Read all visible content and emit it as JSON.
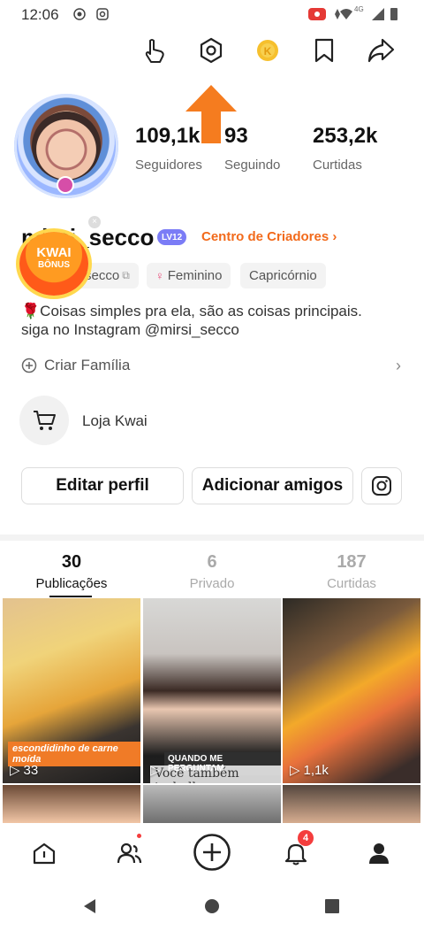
{
  "status_bar": {
    "time": "12:06",
    "network": "4G"
  },
  "profile": {
    "followers_count": "109,1k",
    "followers_label": "Seguidores",
    "following_count": "93",
    "following_label": "Seguindo",
    "likes_count": "253,2k",
    "likes_label": "Curtidas",
    "username": "mirsi_secco",
    "level": "LV12",
    "creator_center": "Centro de Criadores",
    "chips": [
      "secco",
      "Feminino",
      "Capricórnio"
    ],
    "bio": "🌹Coisas simples pra ela, são as coisas principais. siga no Instagram @mirsi_secco",
    "family_label": "Criar Família",
    "store_label": "Loja Kwai",
    "bonus_title": "KWAI",
    "bonus_sub": "BÔNUS"
  },
  "buttons": {
    "edit_profile": "Editar perfil",
    "add_friends": "Adicionar amigos"
  },
  "tabs": [
    {
      "count": "30",
      "label": "Publicações"
    },
    {
      "count": "6",
      "label": "Privado"
    },
    {
      "count": "187",
      "label": "Curtidas"
    }
  ],
  "grid": [
    {
      "views": "33",
      "caption": "escondidinho de carne moída"
    },
    {
      "views": "",
      "caption_top": "QUANDO ME PERGUNTAM",
      "caption_bottom": "Você também trabalha"
    },
    {
      "views": "1,1k",
      "caption": ""
    }
  ],
  "notifications_badge": "4",
  "colors": {
    "accent": "#f26a1b",
    "badge": "#f43d3d",
    "level": "#7b7cf6"
  }
}
